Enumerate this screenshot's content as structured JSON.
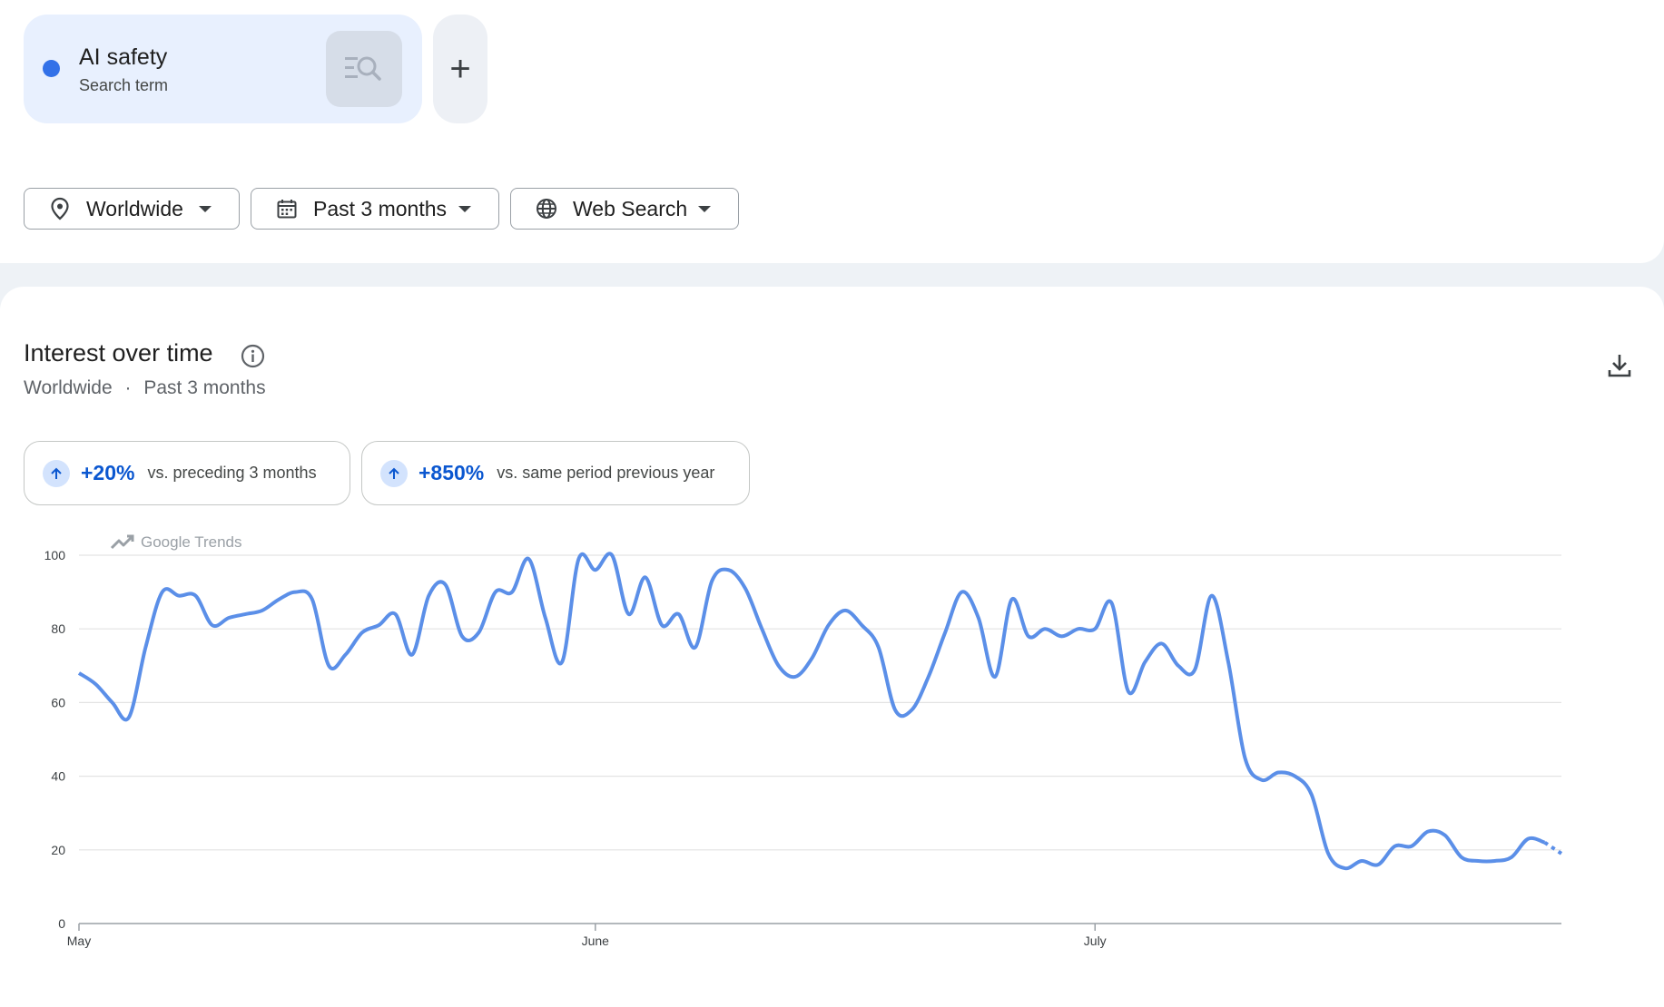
{
  "search_term": {
    "name": "AI safety",
    "type": "Search term",
    "color": "#3271e8"
  },
  "add_button": {
    "label": "+"
  },
  "filters": {
    "region": "Worldwide",
    "period": "Past 3 months",
    "property": "Web Search"
  },
  "section": {
    "title": "Interest over time",
    "region": "Worldwide",
    "separator": "·",
    "period": "Past 3 months"
  },
  "stats": [
    {
      "value": "+20%",
      "label": "vs. preceding 3 months"
    },
    {
      "value": "+850%",
      "label": "vs. same period previous year"
    }
  ],
  "watermark": "Google Trends",
  "chart_data": {
    "type": "line",
    "ylim": [
      0,
      100
    ],
    "yticks": [
      0,
      20,
      40,
      60,
      80,
      100
    ],
    "grid": true,
    "xticks": [
      {
        "label": "May",
        "index": 0
      },
      {
        "label": "June",
        "index": 31
      },
      {
        "label": "July",
        "index": 61
      }
    ],
    "series": [
      {
        "color": "#5b8fe8",
        "values": [
          68,
          65,
          60,
          56,
          75,
          90,
          89,
          89,
          81,
          83,
          84,
          85,
          88,
          90,
          88,
          70,
          73,
          79,
          81,
          84,
          73,
          89,
          92,
          78,
          79,
          90,
          90,
          99,
          83,
          71,
          99,
          96,
          100,
          84,
          94,
          81,
          84,
          75,
          93,
          96,
          91,
          80,
          70,
          67,
          72,
          81,
          85,
          81,
          75,
          58,
          58,
          67,
          79,
          90,
          83,
          67,
          88,
          78,
          80,
          78,
          80,
          80,
          87,
          63,
          71,
          76,
          70,
          69,
          89,
          71,
          45,
          39,
          41,
          40,
          35,
          19,
          15,
          17,
          16,
          21,
          21,
          25,
          24,
          18,
          17,
          17,
          18,
          23,
          22,
          19
        ],
        "partial_last_points": 2
      }
    ]
  }
}
